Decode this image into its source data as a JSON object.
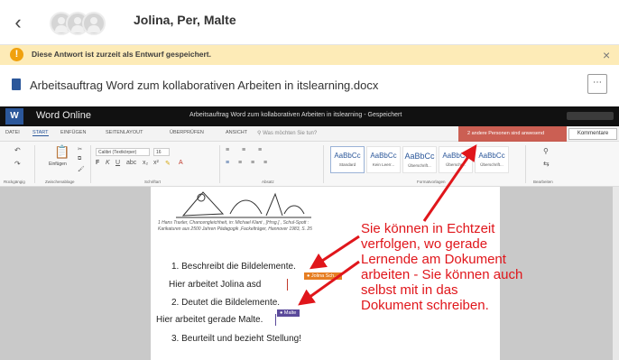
{
  "conversation": {
    "title": "Jolina, Per, Malte",
    "back_icon": "chevron-left-icon"
  },
  "banner": {
    "text": "Diese Antwort ist zurzeit als Entwurf gespeichert.",
    "color": "#fdebb7",
    "icon": "warning-icon"
  },
  "document": {
    "title": "Arbeitsauftrag Word zum kollaborativen Arbeiten in itslearning.docx",
    "more_label": "⋯"
  },
  "word_bar": {
    "logo": "W",
    "app_name": "Word Online",
    "doc_status": "Arbeitsauftrag Word zum kollaborativen Arbeiten in itslearning   -   Gespeichert"
  },
  "menu": {
    "tabs": [
      "DATEI",
      "START",
      "EINFÜGEN",
      "SEITENLAYOUT",
      "ÜBERPRÜFEN",
      "ANSICHT"
    ],
    "search_placeholder": "Was möchten Sie tun?",
    "presence": "2 andere Personen sind anwesend",
    "comments": "Kommentare"
  },
  "ribbon": {
    "font_name": "Calibri (Textkörper)",
    "font_size": "16",
    "paste_label": "Einfügen",
    "groups": [
      "Rückgängig",
      "Zwischenablage",
      "Schriftart",
      "Absatz",
      "Formatvorlagen",
      "Bearbeiten"
    ],
    "styles": [
      {
        "sample": "AaBbCc",
        "name": "Standard"
      },
      {
        "sample": "AaBbCc",
        "name": "Kein Leerr..."
      },
      {
        "sample": "AaBbCc",
        "name": "Überschrift..."
      },
      {
        "sample": "AaBbCc",
        "name": "Überschr..."
      },
      {
        "sample": "AaBbCc",
        "name": "Überschrift..."
      }
    ]
  },
  "page": {
    "caption": "1 Hans Traxler, Chancengleichheit, in: Michael Klant , [Hrsg.] , Schul-Spott : Karikaturen aus 2500 Jahren Pädagogik ,Fackelträger, Hannover 1983, S. 25",
    "item1": "1. Beschreibt die Bildelemente.",
    "line_jolina": "Hier arbeitet Jolina  asd",
    "item2": "2. Deutet die Bildelemente.",
    "line_malte": "Hier arbeitet gerade Malte.",
    "item3": "3. Beurteilt und bezieht Stellung!",
    "flag_jolina": "Jolina Sch...",
    "flag_malte": "Malte"
  },
  "annotation": {
    "text": "Sie können in Echtzeit verfolgen, wo gerade Lernende am Dokument arbeiten - Sie können auch selbst mit in das Dokument schreiben.",
    "color": "#e0161b"
  }
}
